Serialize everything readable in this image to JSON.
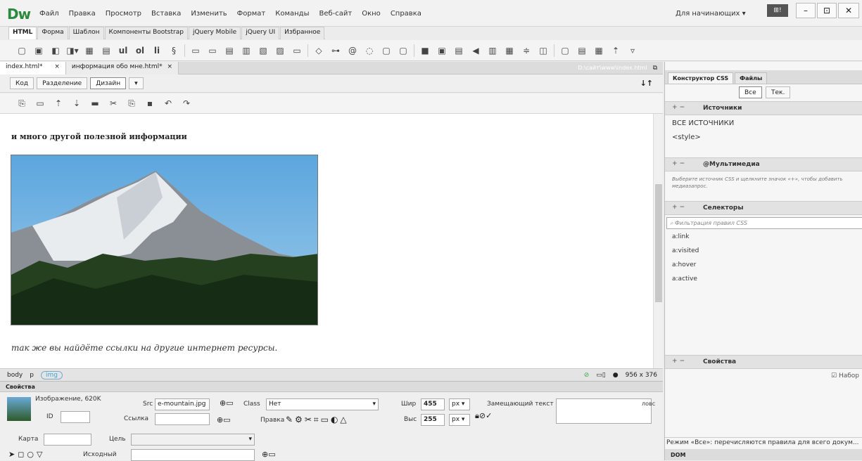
{
  "app": {
    "logo": "Dw",
    "menu": [
      "Файл",
      "Правка",
      "Просмотр",
      "Вставка",
      "Изменить",
      "Формат",
      "Команды",
      "Веб-сайт",
      "Окно",
      "Справка"
    ],
    "workspace": "Для начинающих",
    "workspace_btn": "⊞!"
  },
  "window_controls": {
    "min": "–",
    "max": "⊡",
    "close": "✕"
  },
  "insert_tabs": [
    "HTML",
    "Форма",
    "Шаблон",
    "Компоненты Bootstrap",
    "jQuery Mobile",
    "jQuery UI",
    "Избранное"
  ],
  "doc_tabs": [
    {
      "label": "index.html*",
      "close": "×"
    },
    {
      "label": "информация обо мне.html*",
      "close": "×"
    }
  ],
  "doc_path": "D:\\сайт\\www\\index.html",
  "view_buttons": [
    "Код",
    "Разделение",
    "Дизайн"
  ],
  "canvas": {
    "heading": "и много другой полезной информации",
    "paragraph": "так же вы найдёте ссылки на другие интернет ресурсы."
  },
  "status": {
    "tags": [
      "body",
      "p",
      "img"
    ],
    "size": "956 x 376"
  },
  "properties": {
    "title": "Свойства",
    "image_label": "Изображение, 620K",
    "id_label": "ID",
    "id_value": "",
    "src_label": "Src",
    "src_value": "e-mountain.jpg",
    "link_label": "Ссылка",
    "link_value": "",
    "class_label": "Class",
    "class_value": "Нет",
    "edit_label": "Правка",
    "width_label": "Шир",
    "width_value": "455",
    "unit_w": "px",
    "height_label": "Выс",
    "height_value": "255",
    "unit_h": "px",
    "alt_label": "Замещающий текст",
    "title_label": "ловс",
    "map_label": "Карта",
    "target_label": "Цель",
    "original_label": "Исходный"
  },
  "right_panel": {
    "tabs": [
      "Конструктор CSS",
      "Файлы"
    ],
    "buttons": [
      "Все",
      "Тек."
    ],
    "sources_title": "Источники",
    "sources": [
      "ВСЕ ИСТОЧНИКИ",
      "<style>"
    ],
    "media_title": "@Мультимедиа",
    "media_note": "Выберите источник CSS и щелкните значок «+», чтобы добавить медиазапрос.",
    "selectors_title": "Селекторы",
    "filter_placeholder": "Фильтрация правил CSS",
    "selectors": [
      "a:link",
      "a:visited",
      "a:hover",
      "a:active"
    ],
    "properties_title": "Свойства",
    "show_set": "Набор",
    "footer": "Режим «Все»: перечисляются правила для всего докум...",
    "dom": "DOM"
  }
}
